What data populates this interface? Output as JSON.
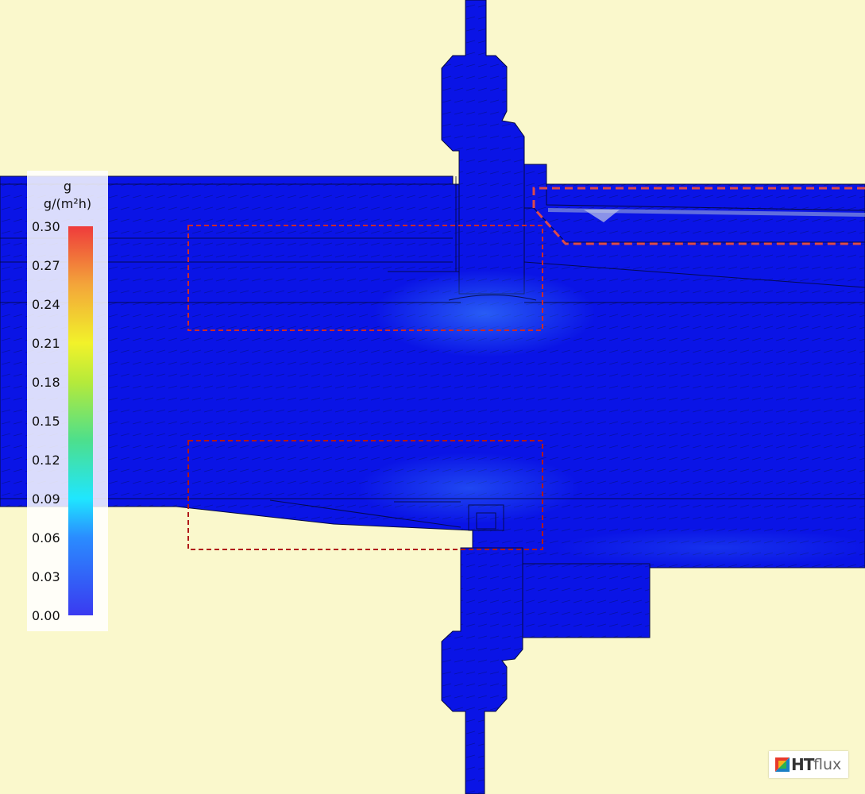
{
  "legend": {
    "title": "g",
    "unit": "g/(m²h)",
    "ticks": [
      "0.30",
      "0.27",
      "0.24",
      "0.21",
      "0.18",
      "0.15",
      "0.12",
      "0.09",
      "0.06",
      "0.03",
      "0.00"
    ]
  },
  "logo": {
    "text_bold": "HT",
    "text_light": "flux"
  },
  "colors": {
    "background": "#faf8cc",
    "body": "#0a14e6",
    "highlight": "#1e6cff",
    "marker_box": "#cc2a2a"
  }
}
